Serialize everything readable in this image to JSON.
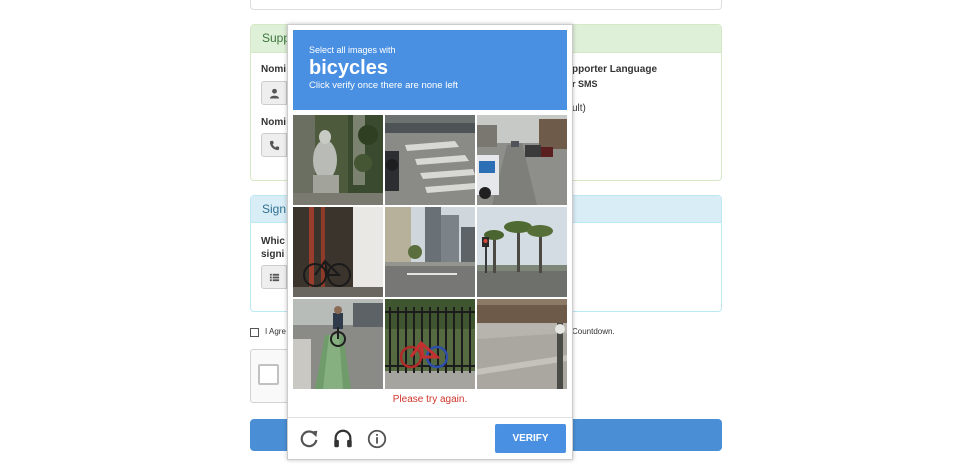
{
  "form": {
    "supporter_panel_title": "Supp",
    "nominee_label_1": "Nomi",
    "nominee_label_2": "Nomi",
    "right_label_line1": "pporter Language",
    "right_label_line2": "r SMS",
    "right_value": "ult)",
    "signature_panel_title": "Sign",
    "which_label_line1": "Whic",
    "which_label_line2": "signi",
    "agree_text": "I Agre",
    "agree_text_right": "Countdown.",
    "colors": {
      "submit": "#4a8fd6",
      "success_header": "#dff0d8",
      "info_header": "#d9edf7"
    }
  },
  "challenge": {
    "instruction": "Select all images with",
    "object": "bicycles",
    "hint": "Click verify once there are none left",
    "error": "Please try again.",
    "verify_label": "VERIFY",
    "accent_color": "#4a90e2",
    "tiles": [
      {
        "id": 1,
        "scene": "statue in foliage"
      },
      {
        "id": 2,
        "scene": "crosswalk road"
      },
      {
        "id": 3,
        "scene": "street with cars"
      },
      {
        "id": 4,
        "scene": "bicycle near red pole"
      },
      {
        "id": 5,
        "scene": "road with buildings"
      },
      {
        "id": 6,
        "scene": "palm trees and traffic light"
      },
      {
        "id": 7,
        "scene": "cyclist in bike lane"
      },
      {
        "id": 8,
        "scene": "red bicycle by fence"
      },
      {
        "id": 9,
        "scene": "sidewalk"
      }
    ],
    "footer_icons": [
      "reload-icon",
      "audio-icon",
      "info-icon"
    ]
  }
}
